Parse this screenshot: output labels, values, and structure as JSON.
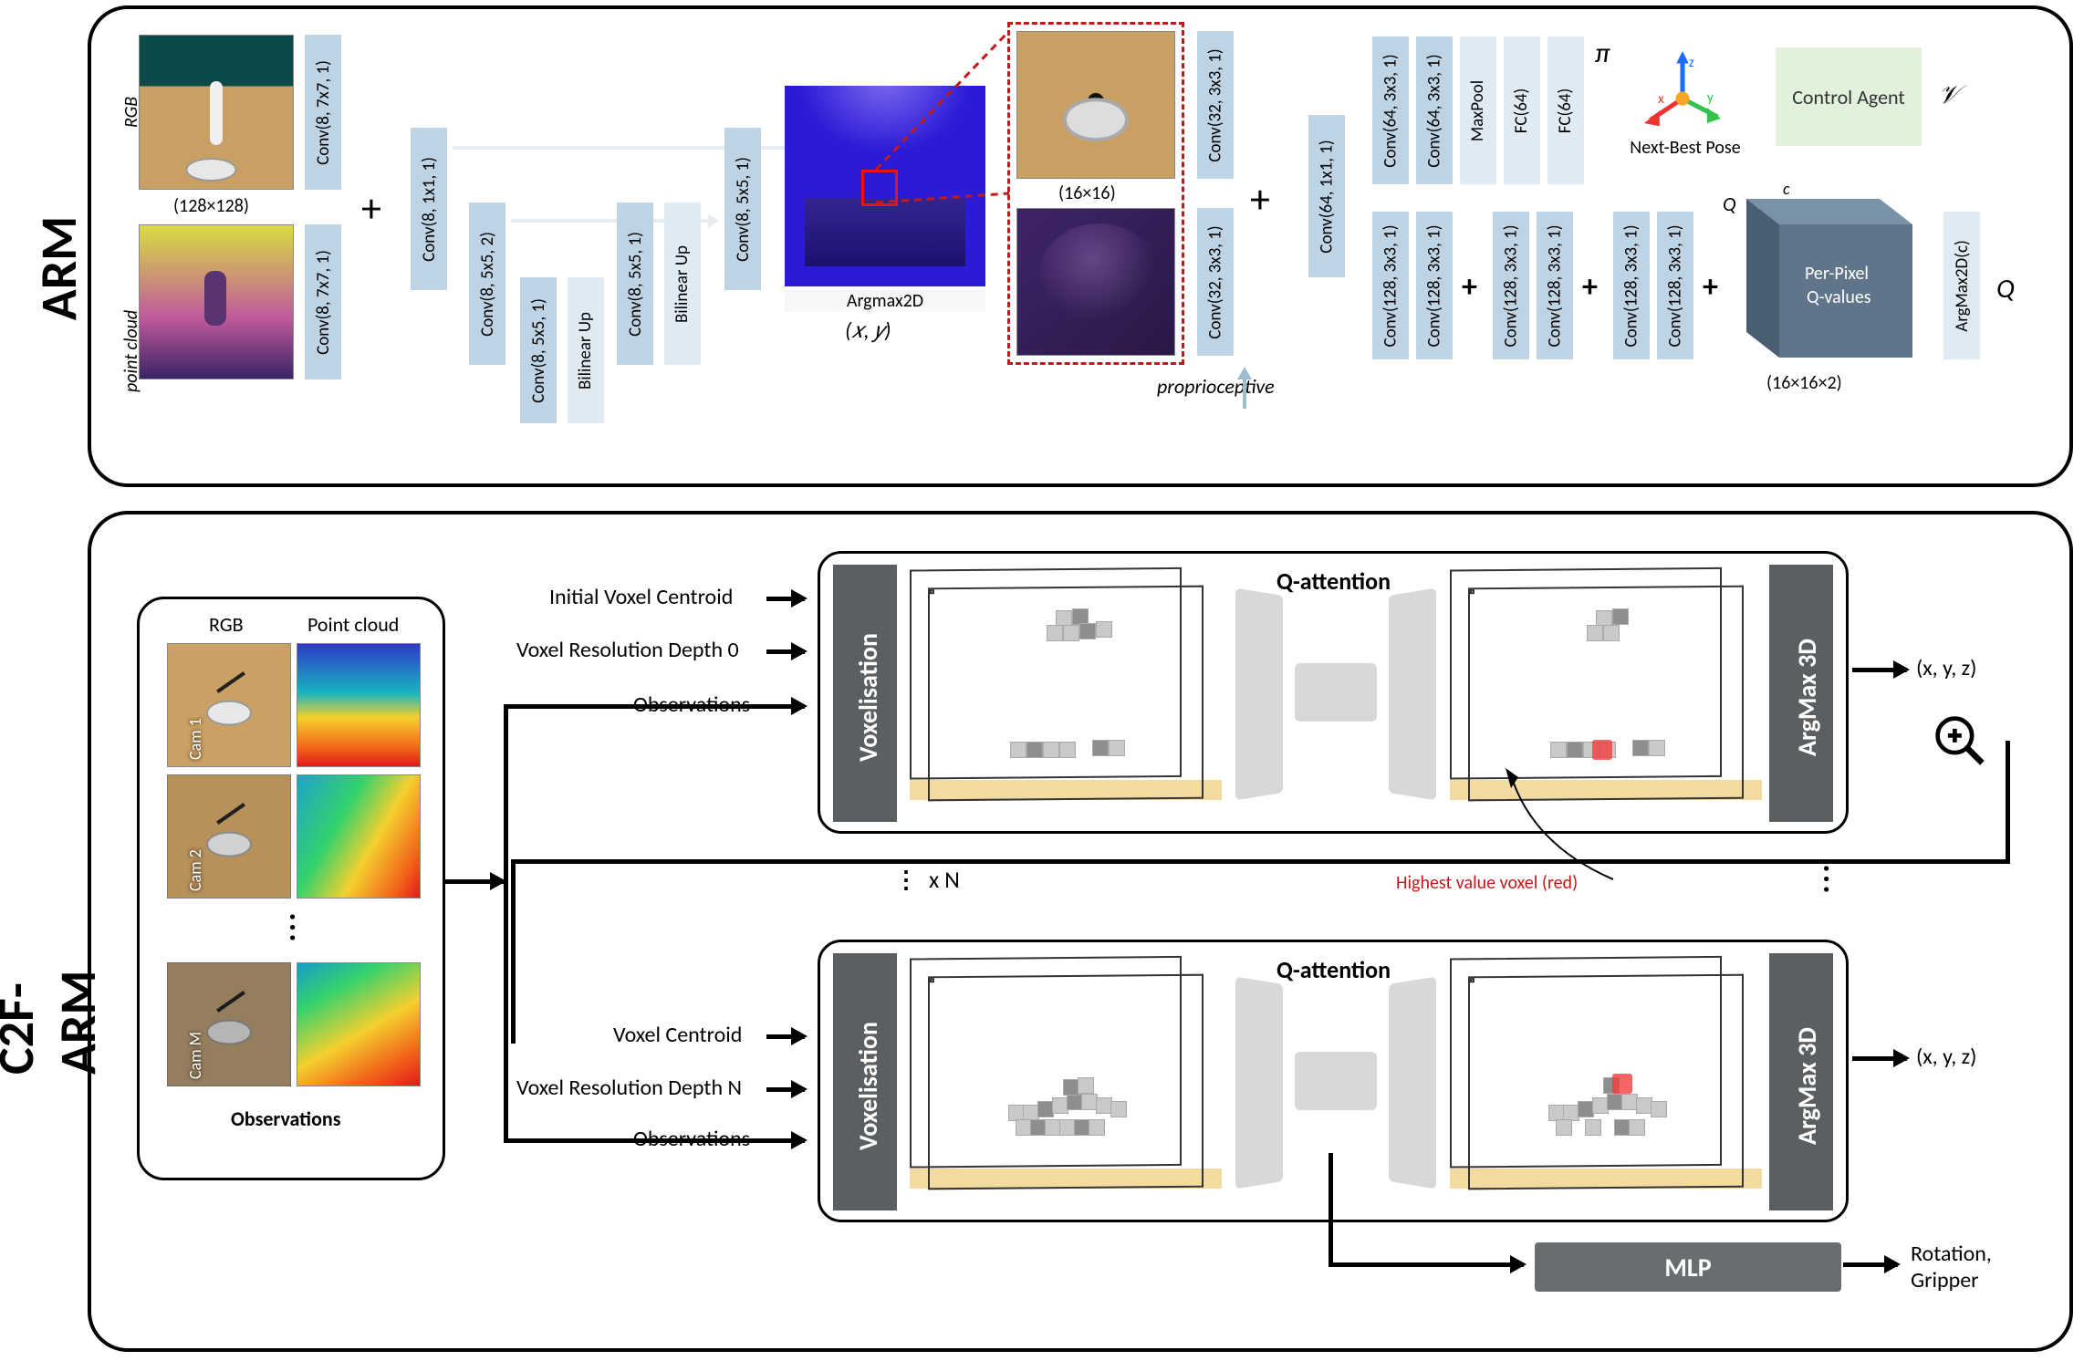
{
  "domain": "Diagram",
  "arm": {
    "panel_label": "ARM",
    "inputs": {
      "rgb": "RGB",
      "point_cloud": "point cloud",
      "dim": "(128×128)"
    },
    "ops_stage1": [
      "Conv(8, 7x7, 1)",
      "Conv(8, 7x7, 1)",
      "Conv(8, 1x1, 1)",
      "Conv(8, 5x5, 2)",
      "Conv(8, 5x5, 1)",
      "Bilinear Up",
      "Conv(8, 5x5, 1)",
      "Bilinear Up",
      "Conv(8, 5x5, 1)"
    ],
    "heatmap_label": "Argmax2D",
    "xy": "(𝑥, 𝑦)",
    "zoom_dim": "(16×16)",
    "proprio": "proprioceptive",
    "ops_stage2": [
      "Conv(32, 3x3, 1)",
      "Conv(32, 3x3, 1)",
      "Conv(64, 1x1, 1)"
    ],
    "head_policy": [
      "Conv(64, 3x3, 1)",
      "Conv(64, 3x3, 1)",
      "MaxPool",
      "FC(64)",
      "FC(64)"
    ],
    "head_q": [
      "Conv(128, 3x3, 1)",
      "Conv(128, 3x3, 1)",
      "Conv(128, 3x3, 1)",
      "Conv(128, 3x3, 1)",
      "Conv(128, 3x3, 1)",
      "Conv(128, 3x3, 1)"
    ],
    "pi": "π",
    "nbp": "Next-Best Pose",
    "control": {
      "label": "Control Agent",
      "out": "𝒱"
    },
    "q": {
      "front": "Per-Pixel Q-values",
      "dim": "(16×16×2)",
      "argmax": "ArgMax2D(c)",
      "Q_symbol": "Q",
      "Q_axis": "Q",
      "c_axis": "c"
    }
  },
  "c2f": {
    "panel_label": "C2F-ARM",
    "obs": {
      "rgb": "RGB",
      "pc": "Point cloud",
      "cams": [
        "Cam 1",
        "Cam 2",
        "Cam M"
      ],
      "caption": "Observations"
    },
    "top_inputs": [
      "Initial Voxel Centroid",
      "Voxel Resolution Depth 0",
      "Observations"
    ],
    "bot_inputs": [
      "Voxel Centroid",
      "Voxel Resolution Depth N",
      "Observations"
    ],
    "slab_left": "Voxelisation",
    "slab_right": "ArgMax 3D",
    "q_title": "Q-attention",
    "red_note": "Highest value voxel (red)",
    "out_xyz": "(x, y, z)",
    "xN": "x N",
    "mlp": "MLP",
    "mlp_out": "Rotation,\nGripper"
  }
}
